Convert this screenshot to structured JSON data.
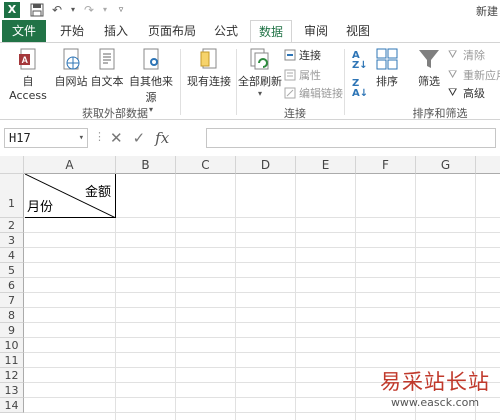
{
  "app": {
    "logo": "X",
    "doc_title": "新建"
  },
  "quick_access": [
    "save-icon",
    "undo-icon",
    "redo-icon",
    "customize-icon"
  ],
  "tabs": [
    "文件",
    "开始",
    "插入",
    "页面布局",
    "公式",
    "数据",
    "审阅",
    "视图"
  ],
  "active_tab": "数据",
  "ribbon": {
    "get_external": {
      "buttons": [
        "自 Access",
        "自网站",
        "自文本",
        "自其他来源"
      ],
      "label": "获取外部数据"
    },
    "existing_conn": "现有连接",
    "refresh_all": "全部刷新",
    "connections": {
      "items": [
        "连接",
        "属性",
        "编辑链接"
      ],
      "label": "连接"
    },
    "sort_filter": {
      "sort": "排序",
      "filter": "筛选",
      "side": [
        "清除",
        "重新应用",
        "高级"
      ],
      "label": "排序和筛选"
    }
  },
  "formula_bar": {
    "name_box": "H17",
    "fx_label": "fx",
    "formula_value": ""
  },
  "grid": {
    "columns": [
      "A",
      "B",
      "C",
      "D",
      "E",
      "F",
      "G"
    ],
    "rows": [
      "1",
      "2",
      "3",
      "4",
      "5",
      "6",
      "7",
      "8",
      "9",
      "10",
      "11",
      "12",
      "13",
      "14"
    ],
    "a1_top_right": "金额",
    "a1_bottom_left": "月份"
  },
  "watermark": {
    "text": "易采站长站",
    "url": "www.easck.com"
  },
  "colors": {
    "excel_green": "#217346",
    "header_bg": "#f3f3f3",
    "watermark_red": "#c0392b"
  }
}
